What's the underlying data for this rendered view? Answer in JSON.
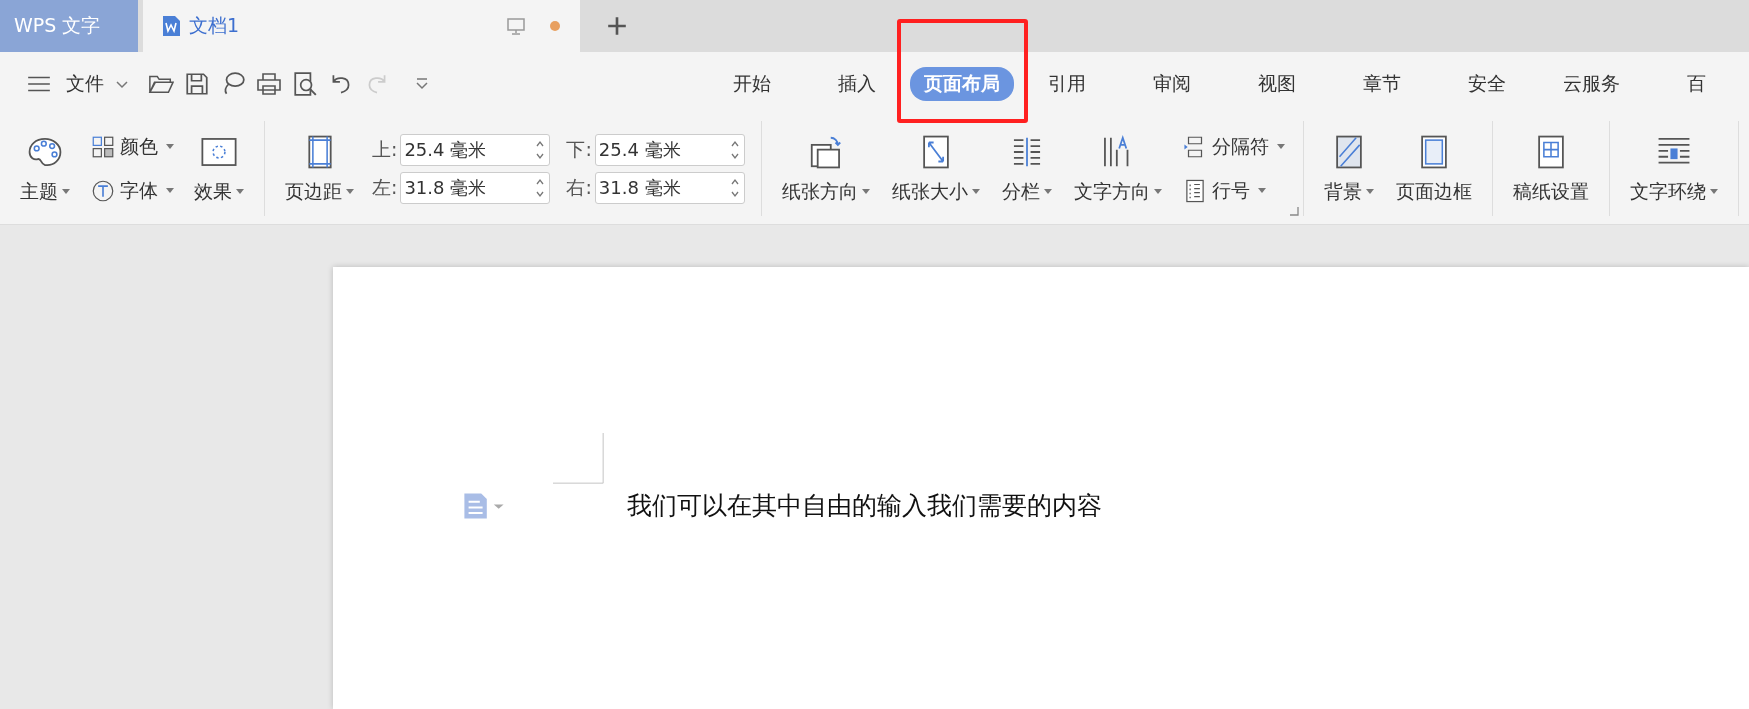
{
  "app_tab": {
    "label": "WPS 文字"
  },
  "doc_tab": {
    "title": "文档1",
    "unsaved": true
  },
  "menu": {
    "file_label": "文件"
  },
  "ribbon_tabs": [
    {
      "label": "开始",
      "selected": false,
      "highlighted": false
    },
    {
      "label": "插入",
      "selected": false,
      "highlighted": false
    },
    {
      "label": "页面布局",
      "selected": true,
      "highlighted": true
    },
    {
      "label": "引用",
      "selected": false,
      "highlighted": false
    },
    {
      "label": "审阅",
      "selected": false,
      "highlighted": false
    },
    {
      "label": "视图",
      "selected": false,
      "highlighted": false
    },
    {
      "label": "章节",
      "selected": false,
      "highlighted": false
    },
    {
      "label": "安全",
      "selected": false,
      "highlighted": false
    },
    {
      "label": "云服务",
      "selected": false,
      "highlighted": false
    },
    {
      "label": "百",
      "selected": false,
      "highlighted": false
    }
  ],
  "ribbon_groups": [
    {
      "launcher": false,
      "items": [
        {
          "kind": "large",
          "label": "主题",
          "dropdown": true
        },
        {
          "kind": "stack",
          "items": [
            {
              "label": "颜色",
              "dropdown": true
            },
            {
              "label": "字体",
              "dropdown": true
            }
          ]
        },
        {
          "kind": "large",
          "label": "效果",
          "dropdown": true
        }
      ]
    },
    {
      "launcher": false,
      "items": [
        {
          "kind": "large",
          "label": "页边距",
          "dropdown": true
        },
        {
          "kind": "margins",
          "fields": [
            {
              "label": "上:",
              "value": "25.4 毫米"
            },
            {
              "label": "下:",
              "value": "25.4 毫米"
            },
            {
              "label": "左:",
              "value": "31.8 毫米"
            },
            {
              "label": "右:",
              "value": "31.8 毫米"
            }
          ]
        }
      ]
    },
    {
      "launcher": true,
      "items": [
        {
          "kind": "large",
          "label": "纸张方向",
          "dropdown": true
        },
        {
          "kind": "large",
          "label": "纸张大小",
          "dropdown": true
        },
        {
          "kind": "large",
          "label": "分栏",
          "dropdown": true
        },
        {
          "kind": "large",
          "label": "文字方向",
          "dropdown": true
        },
        {
          "kind": "stack",
          "items": [
            {
              "label": "分隔符",
              "dropdown": true
            },
            {
              "label": "行号",
              "dropdown": true
            }
          ]
        }
      ]
    },
    {
      "launcher": false,
      "items": [
        {
          "kind": "large",
          "label": "背景",
          "dropdown": true
        },
        {
          "kind": "large",
          "label": "页面边框",
          "dropdown": false
        }
      ]
    },
    {
      "launcher": false,
      "items": [
        {
          "kind": "large",
          "label": "稿纸设置",
          "dropdown": false
        }
      ]
    },
    {
      "launcher": false,
      "items": [
        {
          "kind": "large",
          "label": "文字环绕",
          "dropdown": true
        }
      ]
    }
  ],
  "document": {
    "text": "我们可以在其中自由的输入我们需要的内容"
  }
}
